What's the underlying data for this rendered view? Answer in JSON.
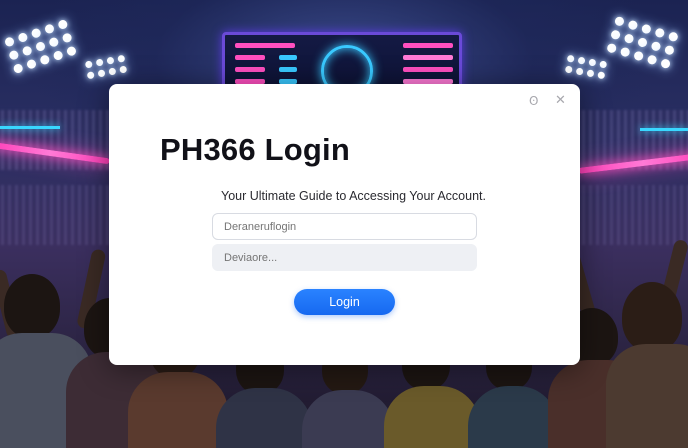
{
  "background": {
    "theme": "stadium-night-crowd",
    "accent_pink": "#ff3fb8",
    "accent_cyan": "#39d7ff"
  },
  "modal": {
    "minimize_icon": "minimize-icon",
    "minimize_glyph": "ʘ",
    "close_icon": "close-icon",
    "close_glyph": "✕",
    "title": "PH366 Login",
    "subtitle": "Your Ultimate Guide to Accessing Your Account.",
    "username": {
      "value": "",
      "placeholder": "Deraneruflogin"
    },
    "password": {
      "value": "",
      "placeholder": "Deviaore..."
    },
    "login_label": "Login",
    "accent_color": "#1a6ef5"
  }
}
